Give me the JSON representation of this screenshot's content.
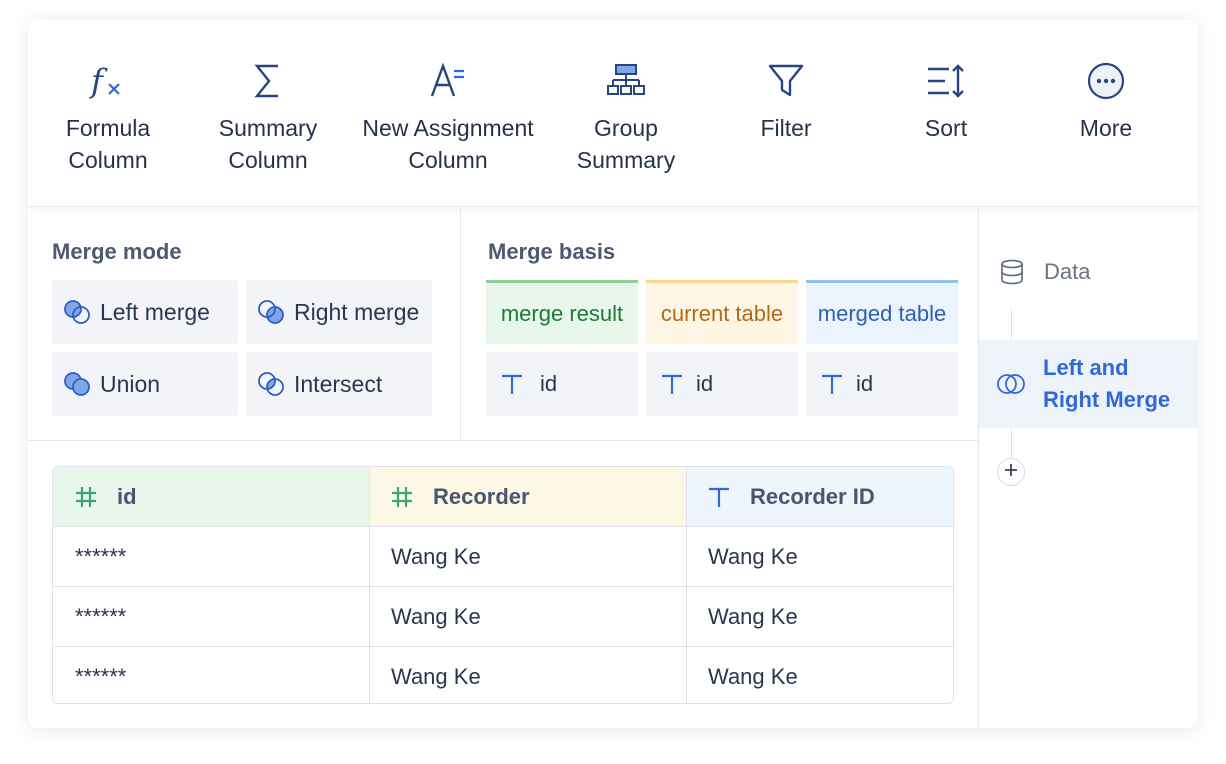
{
  "toolbar": {
    "items": [
      {
        "icon": "formula-icon",
        "label": "Formula\nColumn"
      },
      {
        "icon": "sigma-icon",
        "label": "Summary\nColumn"
      },
      {
        "icon": "assign-icon",
        "label": "New Assignment\nColumn"
      },
      {
        "icon": "group-summary-icon",
        "label": "Group\nSummary"
      },
      {
        "icon": "filter-icon",
        "label": "Filter"
      },
      {
        "icon": "sort-icon",
        "label": "Sort"
      },
      {
        "icon": "more-icon",
        "label": "More"
      }
    ]
  },
  "merge_mode": {
    "title": "Merge mode",
    "options": [
      {
        "icon": "left-merge-icon",
        "label": "Left merge"
      },
      {
        "icon": "right-merge-icon",
        "label": "Right merge"
      },
      {
        "icon": "union-icon",
        "label": "Union"
      },
      {
        "icon": "intersect-icon",
        "label": "Intersect"
      }
    ]
  },
  "merge_basis": {
    "title": "Merge basis",
    "headers": [
      {
        "label": "merge result",
        "color": "#1e7a34",
        "bg": "#e9f6ec",
        "border": "#8ecf9b"
      },
      {
        "label": "current table",
        "color": "#b46a14",
        "bg": "#fdf6e4",
        "border": "#f6d68a"
      },
      {
        "label": "merged table",
        "color": "#2d5fb6",
        "bg": "#ebf4fc",
        "border": "#8fc2f0"
      }
    ],
    "fields": [
      "id",
      "id",
      "id"
    ]
  },
  "table": {
    "columns": [
      {
        "icon": "hash-icon",
        "label": "id",
        "bg": "#e9f6ec"
      },
      {
        "icon": "hash-icon",
        "label": "Recorder",
        "bg": "#fdf8e6"
      },
      {
        "icon": "text-type-icon",
        "label": "Recorder ID",
        "bg": "#eef6fc"
      }
    ],
    "rows": [
      [
        "******",
        "Wang Ke",
        "Wang Ke"
      ],
      [
        "******",
        "Wang Ke",
        "Wang Ke"
      ],
      [
        "******",
        "Wang Ke",
        "Wang Ke"
      ]
    ]
  },
  "flow": {
    "data_label": "Data",
    "step_label": "Left and\nRight Merge",
    "add_icon": "plus-icon"
  },
  "colors": {
    "accent": "#2f6ad9",
    "icon": "#27457f",
    "merge_icon_fill": "#7fa6e6"
  }
}
